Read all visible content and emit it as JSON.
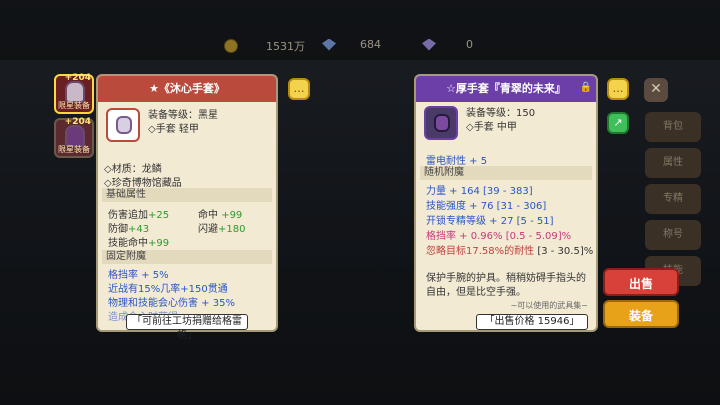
{
  "resources": {
    "gold": "1531万",
    "diamonds": "684",
    "crystals": "0"
  },
  "equipped": [
    {
      "plus": "+204",
      "badge": "限星装备"
    },
    {
      "plus": "+204",
      "badge": "限星装备"
    }
  ],
  "left_panel": {
    "title": "★《沐心手套》",
    "grade_label": "装备等级：",
    "grade_value": "黑星",
    "type_line": "◇手套  轻甲",
    "material_line": "◇材质：龙鳞",
    "collection_line": "◇珍奇博物馆藏品",
    "base_header": "基础属性",
    "base_stats": [
      {
        "label": "伤害追加",
        "value": "+25"
      },
      {
        "label": "命中",
        "value": "+99"
      },
      {
        "label": "防御",
        "value": "+43"
      },
      {
        "label": "闪避",
        "value": "+180"
      },
      {
        "label": "技能命中",
        "value": "+99"
      }
    ],
    "fixed_header": "固定附魔",
    "fixed_enchants": [
      "格挡率 + 5%",
      "近战有15%几率+150贯通",
      "物理和技能会心伤害 + 35%",
      "造成会心时获得..."
    ],
    "footer": "「可前往工坊捐赠给格雷格」"
  },
  "right_panel": {
    "title": "☆厚手套『青翠的未来』",
    "grade_label": "装备等级：",
    "grade_value": "150",
    "type_line": "◇手套  中甲",
    "resist_line": "雷电耐性 + 5",
    "random_header": "随机附魔",
    "random_enchants": [
      {
        "text": "力量 + 164",
        "range": "[39 - 383]"
      },
      {
        "text": "技能强度 + 76",
        "range": "[31 - 306]"
      },
      {
        "text": "开锁专精等级 + 27",
        "range": "[5 - 51]"
      },
      {
        "text": "格挡率 + 0.96%",
        "range": "[0.5 - 5.09]%"
      },
      {
        "text": "忽略目标17.58%的耐性",
        "range": "[3 - 30.5]%"
      }
    ],
    "desc": "保护手腕的护具。稍稍妨碍手指头的自由，但是比空手强。",
    "desc_note": "~可以使用的武具集~",
    "price": "「出售价格 15946」"
  },
  "buttons": {
    "sell": "出售",
    "equip": "装备"
  },
  "side_tabs": [
    "背包",
    "属性",
    "专精",
    "称号",
    "技能"
  ],
  "colors": {
    "left_header": "#b94a3c",
    "right_header": "#6b3ea8",
    "sell": "#d8403a",
    "equip": "#e8a21a"
  }
}
